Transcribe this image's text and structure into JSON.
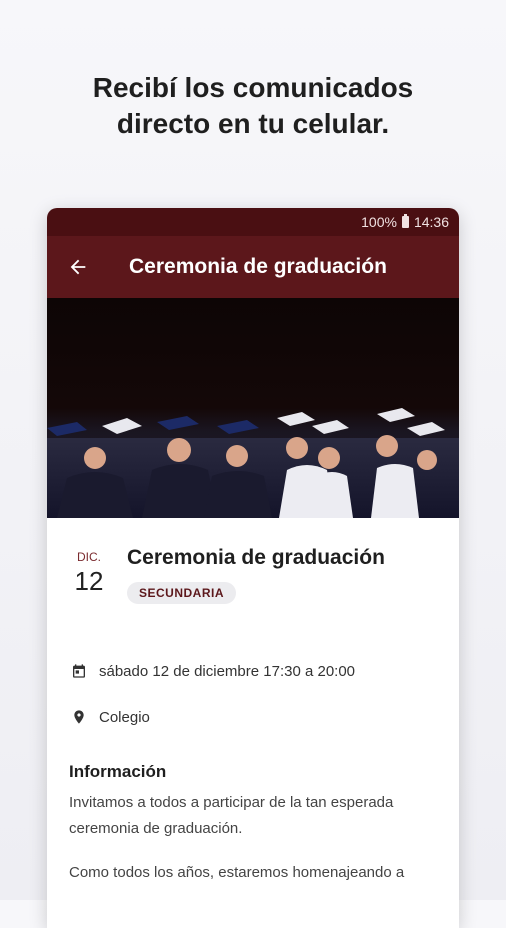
{
  "headline": {
    "line1": "Recibí los comunicados",
    "line2": "directo en tu celular."
  },
  "statusbar": {
    "battery": "100%",
    "time": "14:36"
  },
  "appbar": {
    "back_icon": "arrow-left-icon",
    "title": "Ceremonia de graduación"
  },
  "event": {
    "month": "DIC.",
    "day": "12",
    "title": "Ceremonia de graduación",
    "badge": "SECUNDARIA",
    "datetime": "sábado 12 de diciembre 17:30 a 20:00",
    "location": "Colegio"
  },
  "info": {
    "heading": "Información",
    "paragraph1": "Invitamos a todos a participar de la tan esperada ceremonia de graduación.",
    "paragraph2": "Como todos los años, estaremos homenajeando a"
  },
  "colors": {
    "appbar": "#5c171b",
    "statusbar": "#4a0f12",
    "accent": "#7a2a2e"
  }
}
